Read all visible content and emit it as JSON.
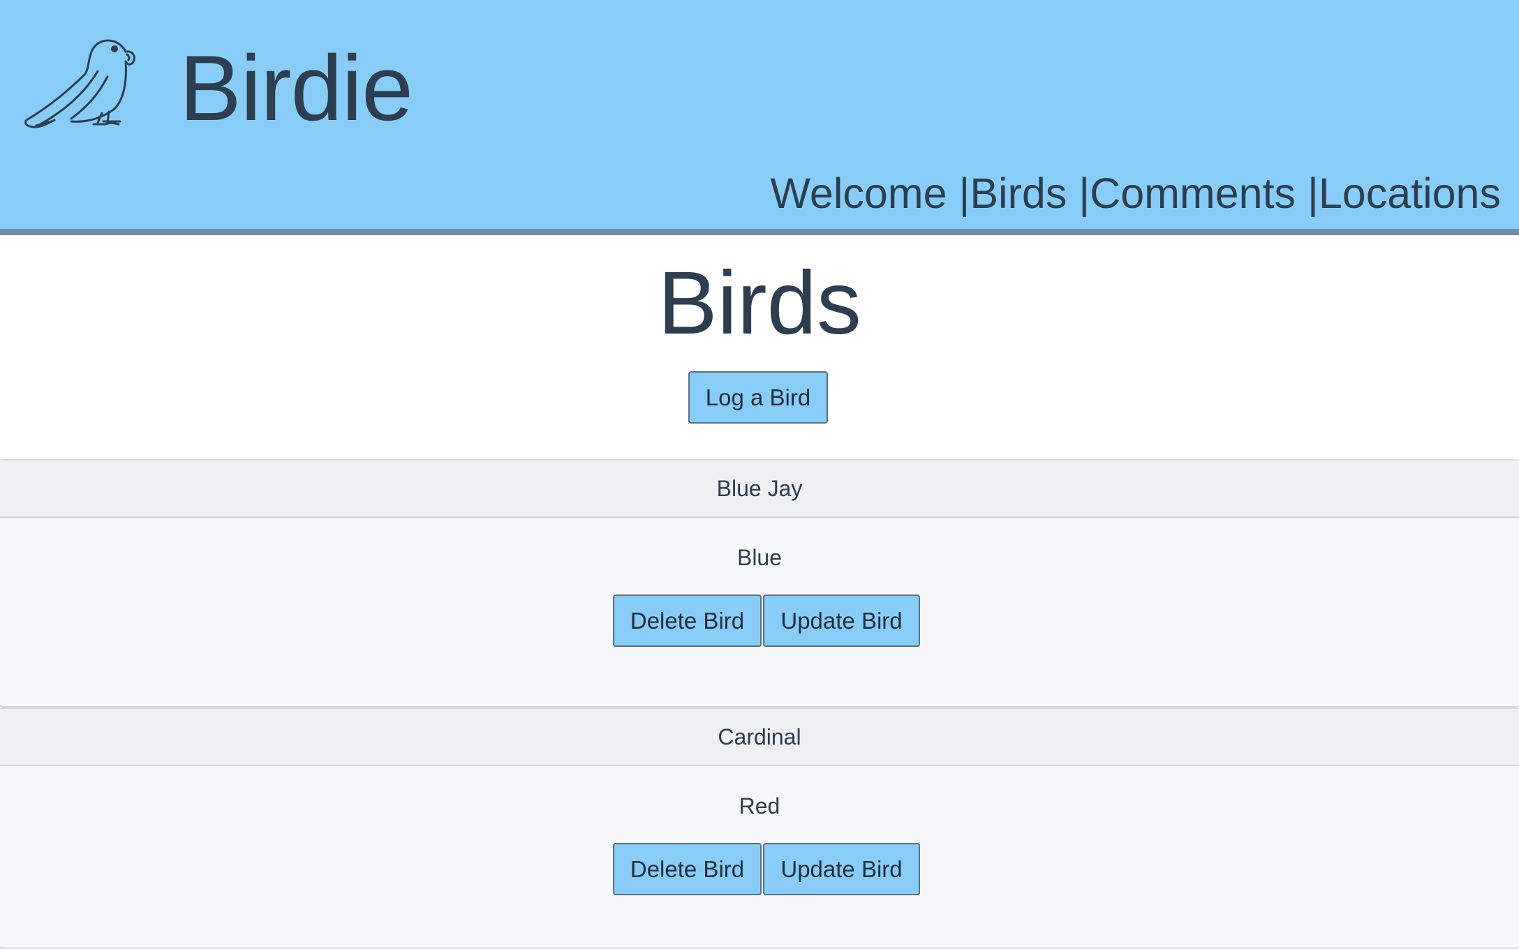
{
  "header": {
    "brand": "Birdie",
    "logo_icon": "parrot-icon",
    "nav": [
      {
        "label": "Welcome "
      },
      {
        "label": "Birds "
      },
      {
        "label": "Comments "
      },
      {
        "label": "Locations"
      }
    ],
    "separator": "|"
  },
  "main": {
    "title": "Birds",
    "log_button": "Log a Bird"
  },
  "birds": [
    {
      "name": "Blue Jay",
      "color": "Blue",
      "delete_label": "Delete Bird",
      "update_label": "Update Bird"
    },
    {
      "name": "Cardinal",
      "color": "Red",
      "delete_label": "Delete Bird",
      "update_label": "Update Bird"
    }
  ],
  "colors": {
    "header_bg": "#87cdf7",
    "header_border": "#6f8aa5",
    "text": "#2c3e50",
    "button_bg": "#87cdf7"
  }
}
